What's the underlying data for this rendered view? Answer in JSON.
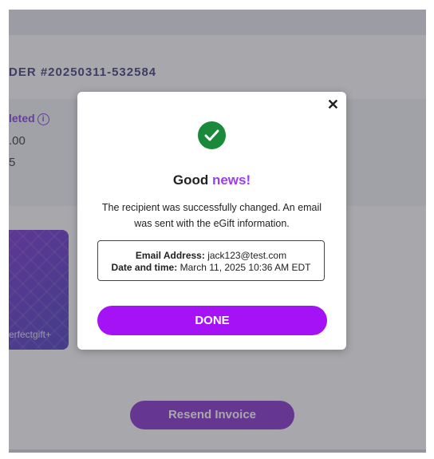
{
  "background": {
    "order_title": "DER #20250311-532584",
    "status_label": "leted",
    "amount": ".00",
    "count": "5",
    "card_brand": "erfectgift+",
    "resend_label": "Resend Invoice"
  },
  "modal": {
    "close_glyph": "✕",
    "headline_prefix": "Good",
    "headline_accent": "news!",
    "message": "The recipient was successfully changed. An email was sent with the eGift information.",
    "email_label": "Email Address:",
    "email_value": "jack123@test.com",
    "date_label": "Date and time:",
    "date_value": "March 11, 2025 10:36 AM EDT",
    "done_label": "DONE"
  },
  "colors": {
    "accent": "#a512f5",
    "success": "#1a8a3a",
    "title": "#2e2a6f"
  }
}
